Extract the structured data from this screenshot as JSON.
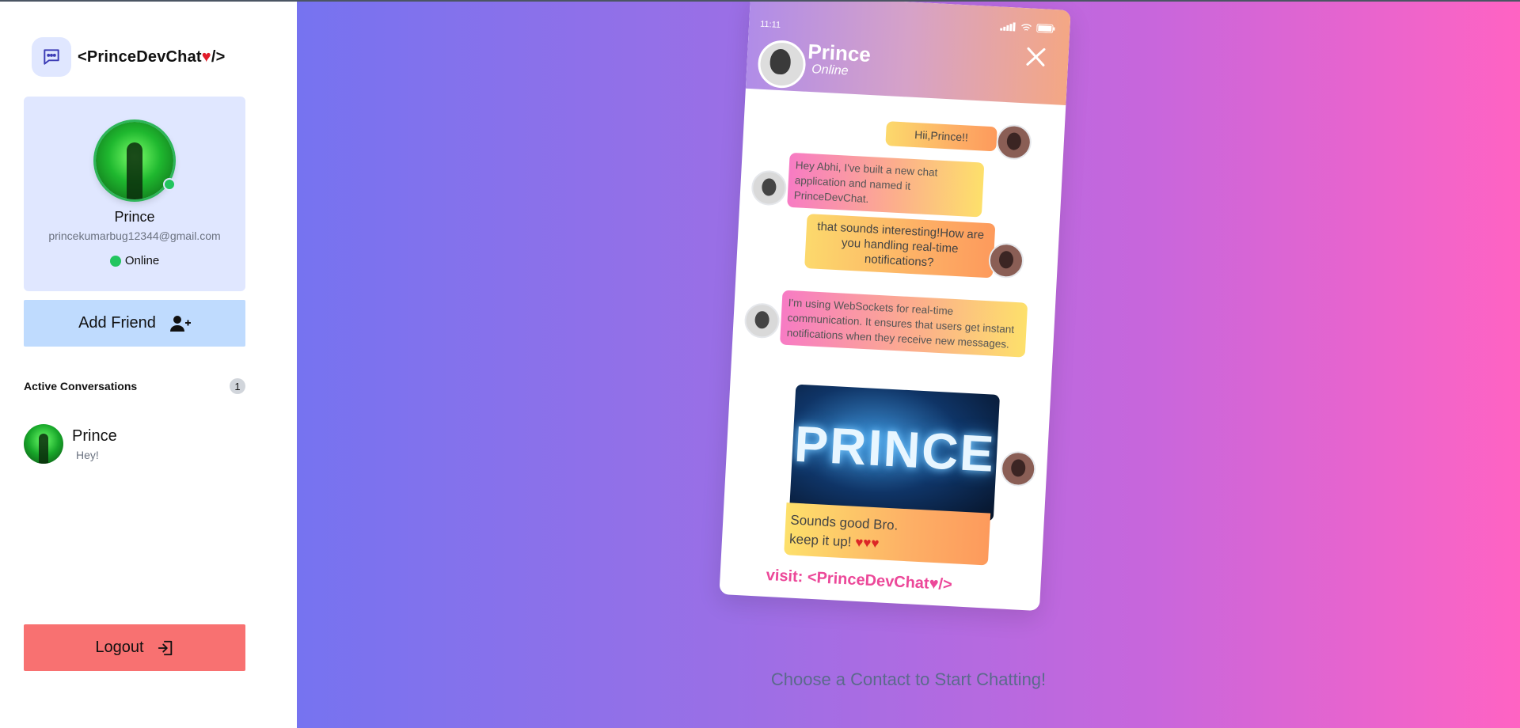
{
  "app": {
    "brand_title": "<PrinceDevChat",
    "brand_heart": "♥",
    "brand_close": "/>"
  },
  "profile": {
    "name": "Prince",
    "email": "princekumarbug12344@gmail.com",
    "status": "Online"
  },
  "buttons": {
    "add_friend": "Add Friend",
    "logout": "Logout"
  },
  "conversations": {
    "title": "Active Conversations",
    "count": "1",
    "items": [
      {
        "name": "Prince",
        "last_message": "Hey!"
      }
    ]
  },
  "preview": {
    "time": "11:11",
    "contact_name": "Prince",
    "contact_status": "Online",
    "messages": [
      "Hii,Prince!!",
      "Hey Abhi, I've built a new chat application and named it PrinceDevChat.",
      "that sounds interesting!How are you handling real-time notifications?",
      "I'm using WebSockets for real-time communication. It ensures that users get instant notifications when they receive new messages.",
      "Sounds good Bro.",
      "keep it up!"
    ],
    "image_text": "PRINCE",
    "caption_hearts": "♥♥♥",
    "visit_text": "visit: <PrinceDevChat♥/>"
  },
  "empty_state": {
    "prompt": "Choose a Contact to Start Chatting!"
  },
  "colors": {
    "accent_blue": "#bfdbfe",
    "logout_red": "#f87171",
    "online_green": "#22c55e",
    "card_bg": "#e0e7ff",
    "gradient_start": "#7673f0",
    "gradient_end": "#ff63c3"
  },
  "icons": {
    "brand": "chat-bubble-icon",
    "add_friend": "user-plus-icon",
    "logout": "logout-icon",
    "close": "close-icon"
  }
}
